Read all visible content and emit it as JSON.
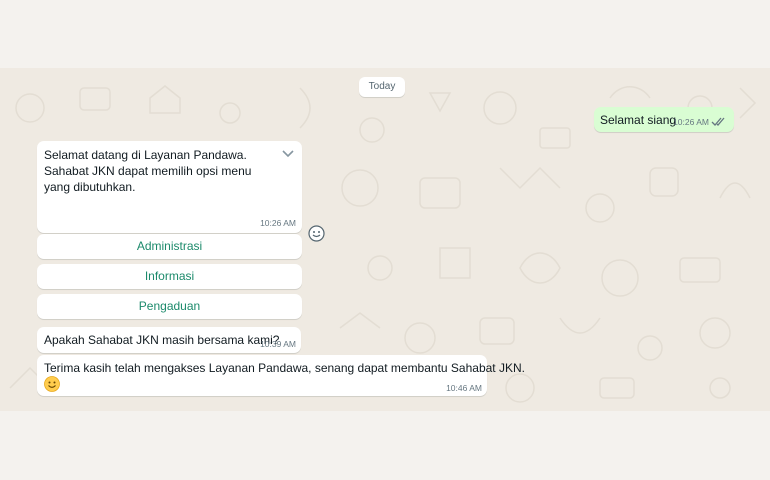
{
  "date_separator": "Today",
  "messages": {
    "outgoing": {
      "text": "Selamat siang",
      "time": "10:26 AM",
      "status_icon": "double-check-icon"
    },
    "welcome": {
      "line1": "Selamat datang di Layanan Pandawa.",
      "line2": "Sahabat JKN dapat memilih opsi menu yang dibutuhkan.",
      "time": "10:26 AM",
      "menu_icon": "chevron-down-icon"
    },
    "menu_buttons": [
      "Administrasi",
      "Informasi",
      "Pengaduan"
    ],
    "question": {
      "text": "Apakah Sahabat JKN masih bersama kami?",
      "time": "10:39 AM"
    },
    "thanks": {
      "text": "Terima kasih telah mengakses Layanan Pandawa, senang dapat membantu Sahabat JKN.",
      "emoji": "smiling-face-emoji",
      "time": "10:46 AM"
    }
  },
  "colors": {
    "chat_background": "#efeae2",
    "outgoing_bubble": "#d9fdd3",
    "incoming_bubble": "#ffffff",
    "button_text": "#1c8a6b",
    "read_ticks": "#53bdeb"
  }
}
